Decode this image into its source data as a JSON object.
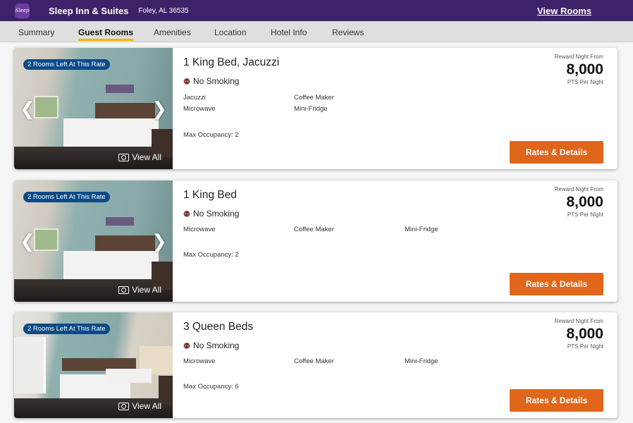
{
  "header": {
    "logo_text": "Sleep",
    "hotel_name": "Sleep Inn & Suites",
    "location": "Foley, AL 36535",
    "view_rooms": "View Rooms"
  },
  "tabs": [
    {
      "label": "Summary",
      "active": false
    },
    {
      "label": "Guest Rooms",
      "active": true
    },
    {
      "label": "Amenities",
      "active": false
    },
    {
      "label": "Location",
      "active": false
    },
    {
      "label": "Hotel Info",
      "active": false
    },
    {
      "label": "Reviews",
      "active": false
    }
  ],
  "rooms": [
    {
      "badge": "2 Rooms Left At This Rate",
      "title": "1 King Bed, Jacuzzi",
      "smoking": "No Smoking",
      "amenities": [
        "Jacuzzi",
        "Coffee Maker",
        "Microwave",
        "Mini-Fridge"
      ],
      "max_occupancy": "Max Occupancy: 2",
      "reward_label": "Reward Night From",
      "points": "8,000",
      "points_unit": "PTS Per Night",
      "button": "Rates & Details",
      "view_all": "View All",
      "has_arrows": true
    },
    {
      "badge": "2 Rooms Left At This Rate",
      "title": "1 King Bed",
      "smoking": "No Smoking",
      "amenities": [
        "Microwave",
        "Coffee Maker",
        "Mini-Fridge"
      ],
      "max_occupancy": "Max Occupancy: 2",
      "reward_label": "Reward Night From",
      "points": "8,000",
      "points_unit": "PTS Per Night",
      "button": "Rates & Details",
      "view_all": "View All",
      "has_arrows": true
    },
    {
      "badge": "2 Rooms Left At This Rate",
      "title": "3 Queen Beds",
      "smoking": "No Smoking",
      "amenities": [
        "Microwave",
        "Coffee Maker",
        "Mini-Fridge"
      ],
      "max_occupancy": "Max Occupancy: 6",
      "reward_label": "Reward Night From",
      "points": "8,000",
      "points_unit": "PTS Per Night",
      "button": "Rates & Details",
      "view_all": "View All",
      "has_arrows": false
    }
  ],
  "colors": {
    "header_bg": "#3d226a",
    "tab_underline": "#f0b400",
    "badge_bg": "#0d4a86",
    "button_bg": "#e0661b"
  }
}
